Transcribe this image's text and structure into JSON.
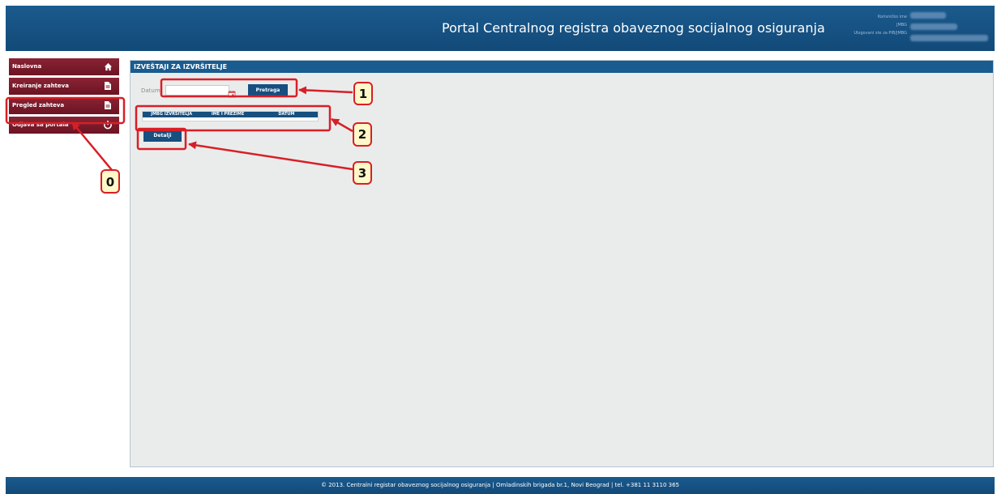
{
  "header": {
    "title": "Portal Centralnog registra obaveznog socijalnog osiguranja",
    "user_labels": [
      "Korisničko ime",
      "JMBG",
      "Ulogovani ste za PIB/JMBG"
    ]
  },
  "sidebar": {
    "items": [
      {
        "label": "Naslovna",
        "icon": "home-icon"
      },
      {
        "label": "Kreiranje zahteva",
        "icon": "document-icon"
      },
      {
        "label": "Pregled zahteva",
        "icon": "document-icon"
      },
      {
        "label": "Odjava sa portala",
        "icon": "power-icon"
      }
    ]
  },
  "main": {
    "title": "IZVEŠTAJI ZA IZVRŠITELJE",
    "datum_label": "Datum",
    "date_value": "",
    "search_label": "Pretraga",
    "table_headers": [
      "JMBG IZVRŠITELJA",
      "IME I PREZIME",
      "DATUM"
    ],
    "details_label": "Detalji"
  },
  "annotations": [
    "0",
    "1",
    "2",
    "3"
  ],
  "footer": {
    "text": "© 2013. Centralni registar obaveznog socijalnog osiguranja | Omladinskih brigada br.1, Novi Beograd | tel. +381 11 3110 365"
  },
  "colors": {
    "header_blue": "#1b5a8e",
    "sidebar_red": "#7f1c2d",
    "annotation_red": "#d81f26",
    "annotation_fill": "#fff8c9"
  }
}
